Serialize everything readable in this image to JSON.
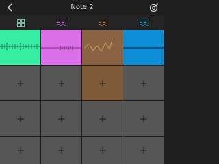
{
  "header": {
    "title": "Note 2",
    "back_icon": "chevron-left-icon",
    "menu_icon": "target-edit-icon"
  },
  "tabs": [
    {
      "icon": "grid-icon",
      "color": "#36e0a0",
      "active": true
    },
    {
      "icon": "waves-icon",
      "color": "#d96ee0"
    },
    {
      "icon": "waves-icon",
      "color": "#c98a4e"
    },
    {
      "icon": "waves-icon",
      "color": "#3aa3e8"
    }
  ],
  "colors": {
    "green": "#35eea2",
    "magenta": "#db6fe8",
    "brown": "#8a6343",
    "blue": "#0f8ed8",
    "empty": "#555555",
    "highlight": "#7f5a3a"
  },
  "grid": {
    "columns": 4,
    "rows": 4,
    "filled": [
      {
        "col": 0,
        "row": 0,
        "color": "green"
      },
      {
        "col": 1,
        "row": 0,
        "color": "magenta"
      },
      {
        "col": 2,
        "row": 0,
        "color": "brown"
      },
      {
        "col": 3,
        "row": 0,
        "color": "blue"
      },
      {
        "col": 2,
        "row": 1,
        "color": "highlight"
      }
    ]
  }
}
